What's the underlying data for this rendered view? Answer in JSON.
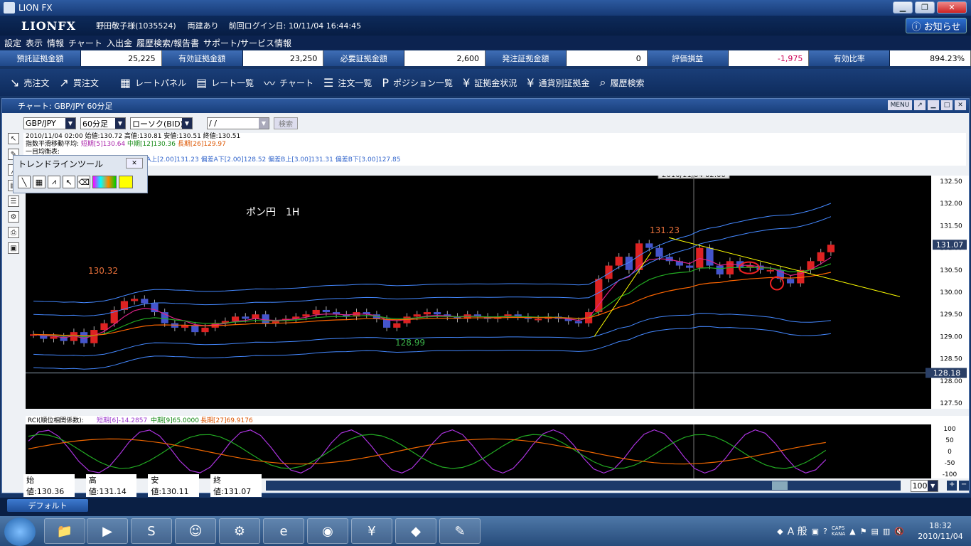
{
  "window": {
    "title": "LION FX"
  },
  "header": {
    "brand": "LIONFX",
    "account": "野田敬子様(1035524)",
    "position_status": "両建あり",
    "last_login": "前回ログイン日: 10/11/04 16:44:45",
    "notice": "お知らせ"
  },
  "menu": [
    "設定",
    "表示",
    "情報",
    "チャート",
    "入出金",
    "履歴検索/報告書",
    "サポート/サービス情報"
  ],
  "margins": [
    {
      "label": "預託証拠金額",
      "value": "25,225",
      "color": "#000000"
    },
    {
      "label": "有効証拠金額",
      "value": "23,250",
      "color": "#000000"
    },
    {
      "label": "必要証拠金額",
      "value": "2,600",
      "color": "#000000"
    },
    {
      "label": "発注証拠金額",
      "value": "0",
      "color": "#000000"
    },
    {
      "label": "評価損益",
      "value": "-1,975",
      "color": "#cc0055"
    },
    {
      "label": "有効比率",
      "value": "894.23%",
      "color": "#000000"
    }
  ],
  "toolbar": [
    {
      "icon": "sell-arrow-icon",
      "label": "売注文"
    },
    {
      "icon": "buy-arrow-icon",
      "label": "買注文"
    },
    {
      "icon": "rate-panel-icon",
      "label": "レートパネル"
    },
    {
      "icon": "rate-list-icon",
      "label": "レート一覧"
    },
    {
      "icon": "chart-icon",
      "label": "チャート"
    },
    {
      "icon": "order-list-icon",
      "label": "注文一覧"
    },
    {
      "icon": "position-icon",
      "label": "ポジション一覧"
    },
    {
      "icon": "yen-icon",
      "label": "証拠金状況"
    },
    {
      "icon": "currency-margin-icon",
      "label": "通貨別証拠金"
    },
    {
      "icon": "history-search-icon",
      "label": "履歴検索"
    }
  ],
  "chart_window": {
    "title": "チャート: GBP/JPY 60分足",
    "menu_label": "MENU",
    "pair": "GBP/JPY",
    "timeframe": "60分足",
    "chart_type": "ローソク(BID)",
    "date_input": "    /   /",
    "search_label": "検索"
  },
  "info": {
    "line1": "2010/11/04 02:00  始値:130.72  高値:130.81  安値:130.51  終値:130.51",
    "ema_label": "指数平滑移動平均:",
    "ema_short": "短期[5]130.64",
    "ema_mid": "中期[12]130.36",
    "ema_long": "長期[26]129.97",
    "ichimoku_label": "一目均衡表:",
    "bb_line": "偏差A上[2.00]131.23  偏差A下[2.00]128.52  偏差B上[3.00]131.31  偏差B下[3.00]127.85"
  },
  "trend_tool": {
    "title": "トレンドラインツール"
  },
  "chart_data": {
    "type": "candlestick",
    "title": "ポン円　1H",
    "cursor_date": "2010/11/04 02:00",
    "ylim": [
      127.5,
      132.5
    ],
    "yticks": [
      "132.50",
      "132.00",
      "131.50",
      "131.00",
      "130.50",
      "130.00",
      "129.50",
      "129.00",
      "128.50",
      "128.00",
      "127.50"
    ],
    "current_price": "131.07",
    "horizontal_line": "128.18",
    "annotations": {
      "high_left": "130.32",
      "low_mid": "128.99",
      "high_right": "131.23"
    },
    "closes": [
      129.05,
      128.95,
      129.0,
      128.9,
      129.1,
      128.85,
      129.15,
      129.3,
      129.6,
      129.8,
      129.85,
      129.75,
      129.55,
      129.3,
      129.2,
      129.25,
      129.1,
      129.2,
      129.3,
      129.35,
      129.45,
      129.4,
      129.5,
      129.3,
      129.35,
      129.4,
      129.45,
      129.5,
      129.6,
      129.55,
      129.5,
      129.45,
      129.55,
      129.5,
      129.4,
      129.2,
      129.3,
      129.45,
      129.5,
      129.55,
      129.5,
      129.45,
      129.4,
      129.5,
      129.45,
      129.4,
      129.45,
      129.5,
      129.45,
      129.4,
      129.4,
      129.45,
      129.4,
      129.35,
      129.3,
      129.55,
      130.3,
      130.6,
      130.8,
      130.5,
      131.1,
      131.0,
      130.8,
      130.7,
      130.6,
      130.55,
      131.0,
      130.6,
      130.4,
      130.7,
      130.55,
      130.6,
      130.5,
      130.5,
      130.3,
      130.2,
      130.5,
      130.7,
      130.9,
      131.07
    ],
    "rci": {
      "short_label": "短期[6]-14.2857",
      "mid_label": "中期[9]65.0000",
      "long_label": "長期[27]69.9176",
      "yticks": [
        "100",
        "50",
        "0",
        "-50",
        "-100"
      ]
    },
    "ohlc_bar": {
      "open": "始値:130.36",
      "high": "高値:131.14",
      "low": "安値:130.11",
      "close": "終値:131.07",
      "zoom": "100"
    }
  },
  "colors": {
    "ema_short": "#dd2288",
    "ema_mid": "#22aa22",
    "ema_long": "#ff6600",
    "bb": "#4488ff",
    "up_candle": "#dd2222",
    "down_candle": "#4455cc"
  },
  "tab": {
    "label": "デフォルト"
  },
  "taskbar": {
    "ime": "A 般",
    "caps": "CAPS",
    "kana": "KANA",
    "time": "18:32",
    "date": "2010/11/04"
  }
}
